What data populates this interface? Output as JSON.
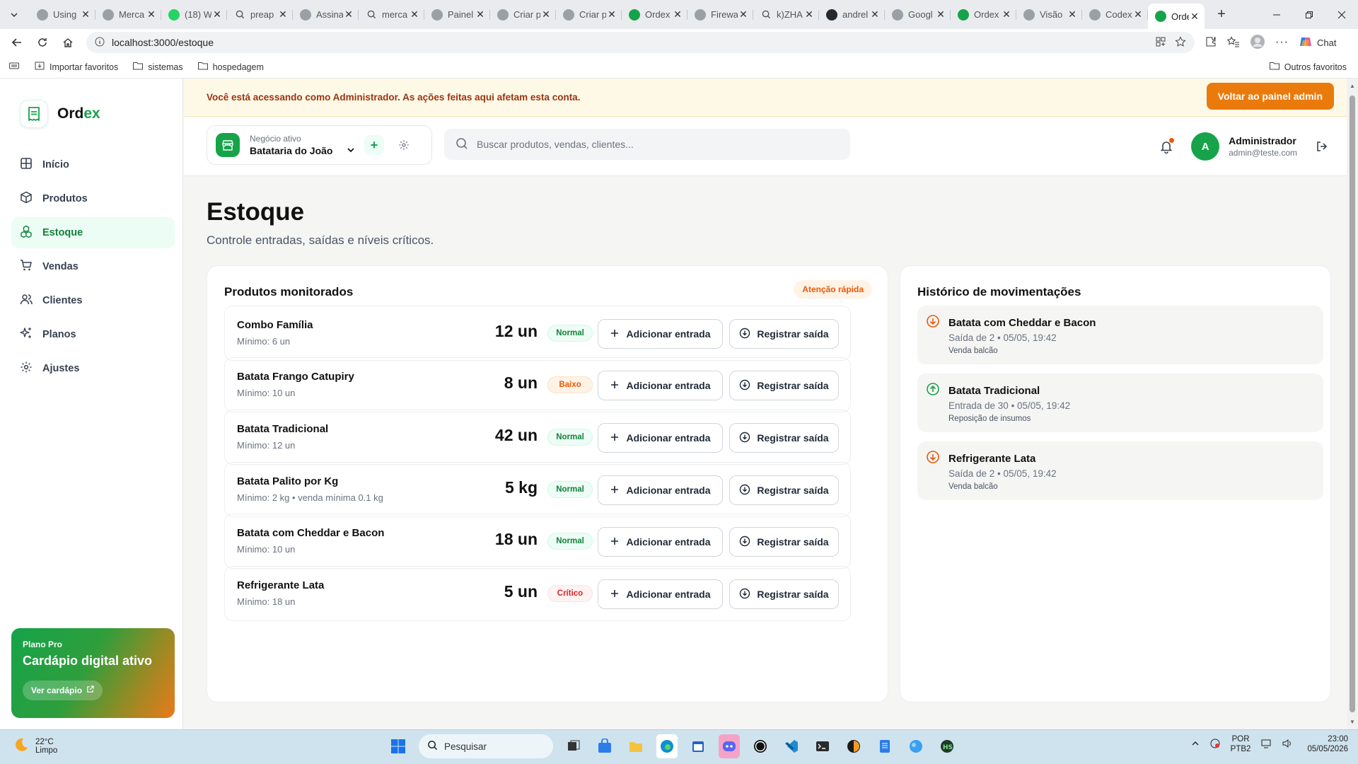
{
  "browser": {
    "tabs": [
      {
        "title": "Using",
        "icon": "generic-tab-icon"
      },
      {
        "title": "Merca",
        "icon": "generic-tab-icon"
      },
      {
        "title": "(18) W",
        "icon": "whatsapp-icon"
      },
      {
        "title": "preap",
        "icon": "search-tab-icon"
      },
      {
        "title": "Assina",
        "icon": "generic-tab-icon"
      },
      {
        "title": "merca",
        "icon": "search-tab-icon"
      },
      {
        "title": "Painel",
        "icon": "generic-tab-icon"
      },
      {
        "title": "Criar p",
        "icon": "generic-tab-icon"
      },
      {
        "title": "Criar p",
        "icon": "generic-tab-icon"
      },
      {
        "title": "Ordex",
        "icon": "ordex-tab-icon"
      },
      {
        "title": "Firewa",
        "icon": "generic-tab-icon"
      },
      {
        "title": "k)ZHA",
        "icon": "search-tab-icon"
      },
      {
        "title": "andrel",
        "icon": "github-icon"
      },
      {
        "title": "Googl",
        "icon": "generic-tab-icon"
      },
      {
        "title": "Ordex",
        "icon": "ordex-tab-icon"
      },
      {
        "title": "Visão",
        "icon": "generic-tab-icon"
      },
      {
        "title": "Codex",
        "icon": "generic-tab-icon"
      },
      {
        "title": "Ordex",
        "icon": "ordex-tab-icon",
        "active": true
      }
    ],
    "url": "localhost:3000/estoque",
    "chat_label": "Chat",
    "bookmarks": [
      "Importar favoritos",
      "sistemas",
      "hospedagem"
    ],
    "other_bookmarks": "Outros favoritos"
  },
  "app": {
    "logo_prefix": "Ord",
    "logo_suffix": "ex",
    "nav": [
      {
        "label": "Início",
        "icon": "home-grid-icon"
      },
      {
        "label": "Produtos",
        "icon": "box-icon"
      },
      {
        "label": "Estoque",
        "icon": "boxes-icon",
        "active": true
      },
      {
        "label": "Vendas",
        "icon": "cart-icon"
      },
      {
        "label": "Clientes",
        "icon": "users-icon"
      },
      {
        "label": "Planos",
        "icon": "sparkles-icon"
      },
      {
        "label": "Ajustes",
        "icon": "gear-icon"
      }
    ],
    "plan": {
      "label": "Plano Pro",
      "title": "Cardápio digital ativo",
      "button": "Ver cardápio"
    },
    "banner": {
      "text": "Você está acessando como Administrador. As ações feitas aqui afetam esta conta.",
      "button": "Voltar ao painel admin"
    },
    "business": {
      "label": "Negócio ativo",
      "name": "Batataria do João"
    },
    "search_placeholder": "Buscar produtos, vendas, clientes...",
    "user": {
      "initial": "A",
      "name": "Administrador",
      "email": "admin@teste.com"
    },
    "page": {
      "title": "Estoque",
      "subtitle": "Controle entradas, saídas e níveis críticos."
    },
    "products_card": {
      "title": "Produtos monitorados",
      "badge": "Atenção rápida",
      "add_label": "Adicionar entrada",
      "out_label": "Registrar saída",
      "items": [
        {
          "name": "Combo Família",
          "min": "Mínimo: 6 un",
          "qty": "12 un",
          "status": "Normal"
        },
        {
          "name": "Batata Frango Catupiry",
          "min": "Mínimo: 10 un",
          "qty": "8 un",
          "status": "Baixo"
        },
        {
          "name": "Batata Tradicional",
          "min": "Mínimo: 12 un",
          "qty": "42 un",
          "status": "Normal"
        },
        {
          "name": "Batata Palito por Kg",
          "min": "Mínimo: 2 kg • venda mínima 0.1 kg",
          "qty": "5 kg",
          "status": "Normal"
        },
        {
          "name": "Batata com Cheddar e Bacon",
          "min": "Mínimo: 10 un",
          "qty": "18 un",
          "status": "Normal"
        },
        {
          "name": "Refrigerante Lata",
          "min": "Mínimo: 18 un",
          "qty": "5 un",
          "status": "Crítico"
        }
      ]
    },
    "history_card": {
      "title": "Histórico de movimentações",
      "items": [
        {
          "title": "Batata com Cheddar e Bacon",
          "detail": "Saída de 2 • 05/05, 19:42",
          "note": "Venda balcão",
          "type": "out"
        },
        {
          "title": "Batata Tradicional",
          "detail": "Entrada de 30 • 05/05, 19:42",
          "note": "Reposição de insumos",
          "type": "in"
        },
        {
          "title": "Refrigerante Lata",
          "detail": "Saída de 2 • 05/05, 19:42",
          "note": "Venda balcão",
          "type": "out"
        }
      ]
    }
  },
  "taskbar": {
    "weather_temp": "22°C",
    "weather_desc": "Limpo",
    "search_placeholder": "Pesquisar",
    "lang_top": "POR",
    "lang_bottom": "PTB2",
    "time": "23:00",
    "date": "05/05/2026"
  },
  "colors": {
    "brand_green": "#16a34a",
    "admin_orange": "#ea7a0b",
    "status_normal": "#15803d",
    "status_low": "#ea580c",
    "status_critical": "#dc2626"
  }
}
